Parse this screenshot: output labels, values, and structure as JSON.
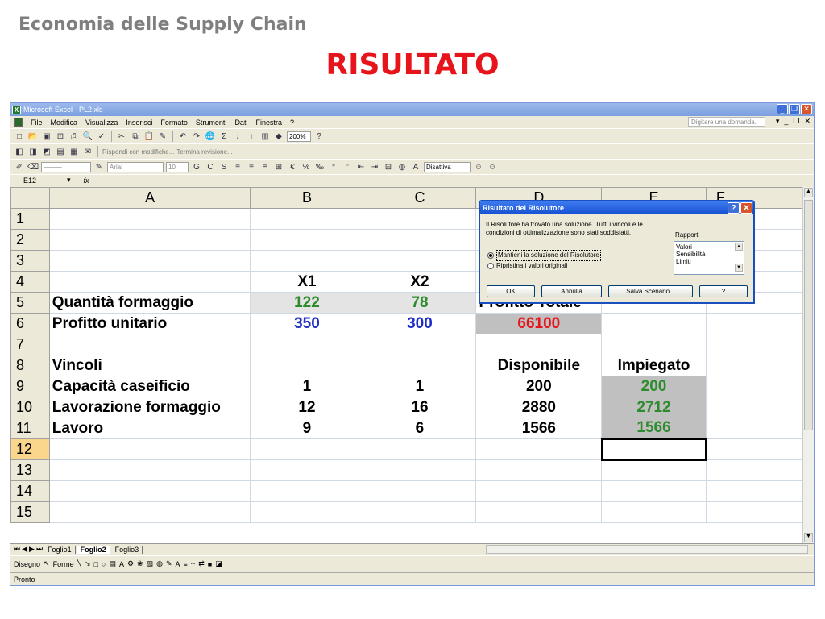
{
  "slide": {
    "subtitle": "Economia delle Supply Chain",
    "title": "RISULTATO"
  },
  "excel": {
    "window_title": "Microsoft Excel - PL2.xls",
    "menu": [
      "File",
      "Modifica",
      "Visualizza",
      "Inserisci",
      "Formato",
      "Strumenti",
      "Dati",
      "Finestra",
      "?"
    ],
    "ask_placeholder": "Digitare una domanda.",
    "zoom": "200%",
    "reply_with_changes": "Rispondi con modifiche...",
    "end_review": "Termina revisione...",
    "font_name": "Arial",
    "font_size": "10",
    "draw_mode": "Disattiva",
    "name_box": "E12",
    "fx": "fx",
    "columns": [
      "A",
      "B",
      "C",
      "D",
      "E",
      "F"
    ],
    "rows": [
      {
        "n": "1",
        "a": "",
        "b": "",
        "c": "",
        "d": "",
        "e": ""
      },
      {
        "n": "2",
        "a": "",
        "b": "",
        "c": "",
        "d": "",
        "e": ""
      },
      {
        "n": "3",
        "a": "",
        "b": "",
        "c": "",
        "d": "",
        "e": ""
      },
      {
        "n": "4",
        "a": "",
        "b": "X1",
        "c": "X2",
        "d": "",
        "e": ""
      },
      {
        "n": "5",
        "a": "Quantità formaggio",
        "b": "122",
        "c": "78",
        "d": "Profitto Totale",
        "e": ""
      },
      {
        "n": "6",
        "a": "Profitto unitario",
        "b": "350",
        "c": "300",
        "d": "66100",
        "e": ""
      },
      {
        "n": "7",
        "a": "",
        "b": "",
        "c": "",
        "d": "",
        "e": ""
      },
      {
        "n": "8",
        "a": "Vincoli",
        "b": "",
        "c": "",
        "d": "Disponibile",
        "e": "Impiegato"
      },
      {
        "n": "9",
        "a": "Capacità caseificio",
        "b": "1",
        "c": "1",
        "d": "200",
        "e": "200"
      },
      {
        "n": "10",
        "a": "Lavorazione formaggio",
        "b": "12",
        "c": "16",
        "d": "2880",
        "e": "2712"
      },
      {
        "n": "11",
        "a": "Lavoro",
        "b": "9",
        "c": "6",
        "d": "1566",
        "e": "1566"
      },
      {
        "n": "12",
        "a": "",
        "b": "",
        "c": "",
        "d": "",
        "e": ""
      },
      {
        "n": "13",
        "a": "",
        "b": "",
        "c": "",
        "d": "",
        "e": ""
      },
      {
        "n": "14",
        "a": "",
        "b": "",
        "c": "",
        "d": "",
        "e": ""
      },
      {
        "n": "15",
        "a": "",
        "b": "",
        "c": "",
        "d": "",
        "e": ""
      }
    ],
    "sheet_tabs": [
      "Foglio1",
      "Foglio2",
      "Foglio3"
    ],
    "draw_label": "Disegno",
    "shapes_label": "Forme",
    "status": "Pronto"
  },
  "dialog": {
    "title": "Risultato del Risolutore",
    "message": "Il Risolutore ha trovato una soluzione. Tutti i vincoli e le condizioni di ottimalizzazione sono stati soddisfatti.",
    "reports_label": "Rapporti",
    "reports": [
      "Valori",
      "Sensibilità",
      "Limiti"
    ],
    "option_keep": "Mantieni la soluzione del Risolutore",
    "option_restore": "Ripristina i valori originali",
    "ok": "OK",
    "cancel": "Annulla",
    "save_scenario": "Salva Scenario...",
    "help": "?"
  }
}
